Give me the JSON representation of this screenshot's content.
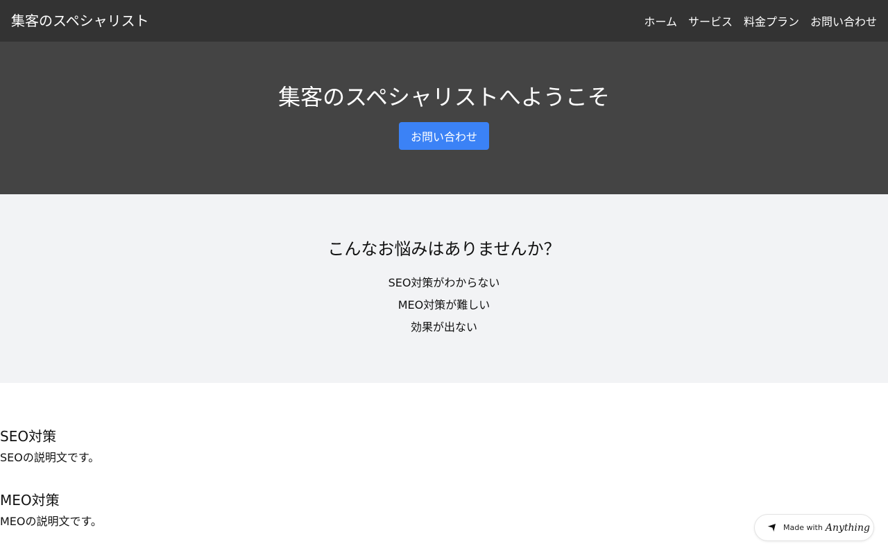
{
  "navbar": {
    "brand": "集客のスペシャリスト",
    "links": [
      {
        "label": "ホーム"
      },
      {
        "label": "サービス"
      },
      {
        "label": "料金プラン"
      },
      {
        "label": "お問い合わせ"
      }
    ]
  },
  "hero": {
    "title": "集客のスペシャリストへようこそ",
    "button_label": "お問い合わせ"
  },
  "problems": {
    "title": "こんなお悩みはありませんか？",
    "items": [
      "SEO対策がわからない",
      "MEO対策が難しい",
      "効果が出ない"
    ]
  },
  "services": [
    {
      "title": "SEO対策",
      "description": "SEOの説明文です。"
    },
    {
      "title": "MEO対策",
      "description": "MEOの説明文です。"
    }
  ],
  "badge": {
    "text": "Made with",
    "brand": "Anything",
    "icon": "anything-logo-icon"
  },
  "colors": {
    "navbar_bg": "#333333",
    "hero_bg": "#444444",
    "accent": "#3b82f6",
    "section_bg": "#f2f3f5"
  }
}
